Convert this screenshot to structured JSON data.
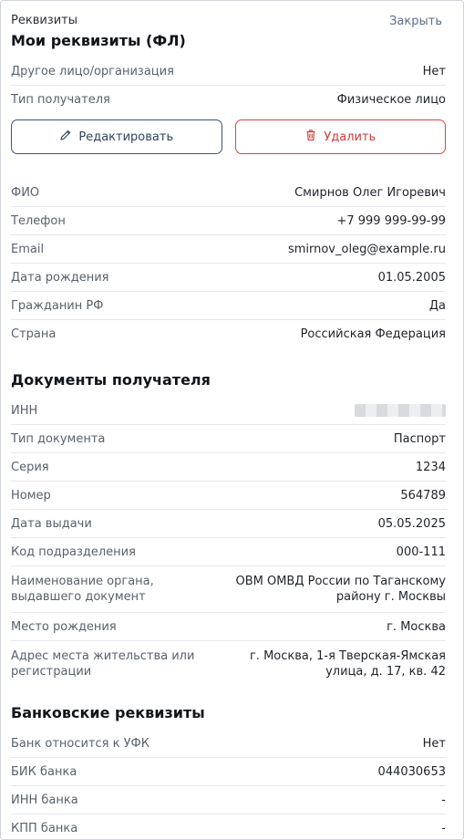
{
  "header": {
    "breadcrumb": "Реквизиты",
    "title": "Мои реквизиты (ФЛ)",
    "close_label": "Закрыть"
  },
  "top_rows": [
    {
      "label": "Другое лицо/организация",
      "value": "Нет"
    },
    {
      "label": "Тип получателя",
      "value": "Физическое лицо"
    }
  ],
  "actions": {
    "edit_label": "Редактировать",
    "delete_label": "Удалить"
  },
  "person_rows": [
    {
      "label": "ФИО",
      "value": "Смирнов Олег Игоревич"
    },
    {
      "label": "Телефон",
      "value": "+7 999 999-99-99"
    },
    {
      "label": "Email",
      "value": "smirnov_oleg@example.ru"
    },
    {
      "label": "Дата рождения",
      "value": "01.05.2005"
    },
    {
      "label": "Гражданин РФ",
      "value": "Да"
    },
    {
      "label": "Страна",
      "value": "Российская Федерация"
    }
  ],
  "documents": {
    "title": "Документы получателя",
    "inn_label": "ИНН",
    "rows": [
      {
        "label": "Тип документа",
        "value": "Паспорт"
      },
      {
        "label": "Серия",
        "value": "1234"
      },
      {
        "label": "Номер",
        "value": "564789"
      },
      {
        "label": "Дата выдачи",
        "value": "05.05.2025"
      },
      {
        "label": "Код подразделения",
        "value": "000-111"
      }
    ],
    "authority": {
      "label": "Наименование органа, выдавшего документ",
      "value": "ОВМ ОМВД России по Таганскому району г. Москвы"
    },
    "birthplace": {
      "label": "Место рождения",
      "value": "г. Москва"
    },
    "address": {
      "label": "Адрес места жительства или регистрации",
      "value": "г. Москва, 1-я Тверская-Ямская улица, д. 17, кв. 42"
    }
  },
  "bank": {
    "title": "Банковские реквизиты",
    "rows": [
      {
        "label": "Банк относится к УФК",
        "value": "Нет"
      },
      {
        "label": "БИК банка",
        "value": "044030653"
      },
      {
        "label": "ИНН банка",
        "value": "-"
      },
      {
        "label": "КПП банка",
        "value": "-"
      }
    ]
  },
  "colors": {
    "edit_border": "#3d5570",
    "delete_accent": "#d94343",
    "close_link": "#5b6f8a"
  }
}
